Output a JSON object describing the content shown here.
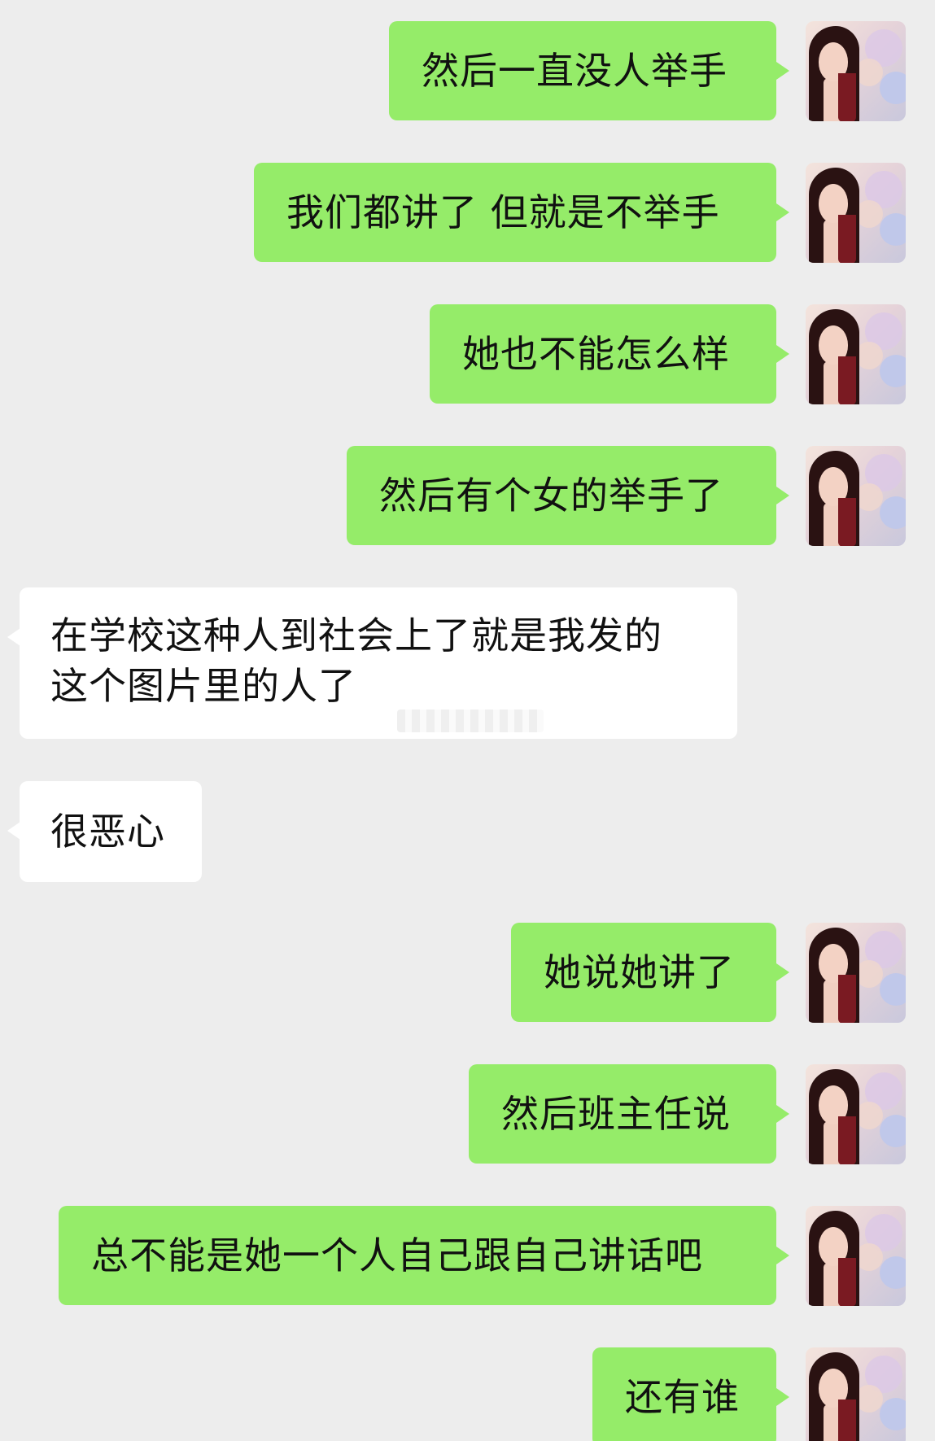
{
  "messages": [
    {
      "side": "sent",
      "text": "然后一直没人举手"
    },
    {
      "side": "sent",
      "text": "我们都讲了 但就是不举手"
    },
    {
      "side": "sent",
      "text": "她也不能怎么样"
    },
    {
      "side": "sent",
      "text": "然后有个女的举手了"
    },
    {
      "side": "recv",
      "lines": [
        "在学校这种人到社会上了就是我发的",
        "这个图片里的人了"
      ]
    },
    {
      "side": "recv",
      "text": "很恶心"
    },
    {
      "side": "sent",
      "text": "她说她讲了"
    },
    {
      "side": "sent",
      "text": "然后班主任说"
    },
    {
      "side": "sent",
      "text": "总不能是她一个人自己跟自己讲话吧"
    },
    {
      "side": "sent",
      "text": "还有谁"
    }
  ],
  "colors": {
    "background": "#ededed",
    "sent_bubble": "#95ec69",
    "received_bubble": "#ffffff",
    "text": "#111111"
  },
  "icons": {
    "avatar": "user-avatar-photo"
  }
}
